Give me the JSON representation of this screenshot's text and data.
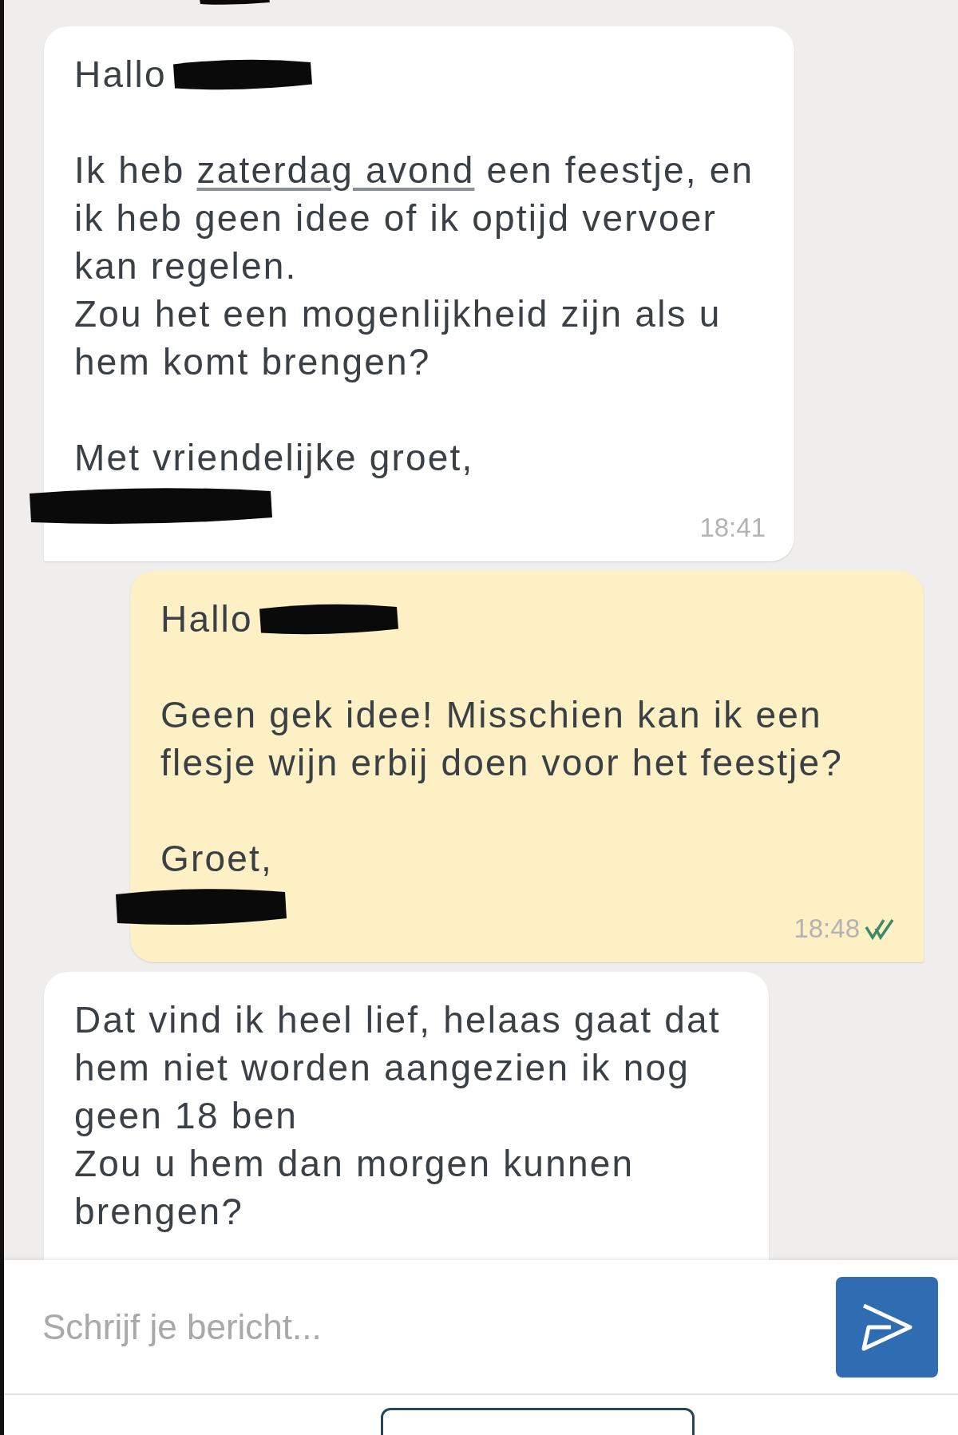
{
  "previous_message": {
    "redacted": true
  },
  "messages": [
    {
      "kind": "incoming",
      "greeting": {
        "text": "Hallo",
        "redacted": true
      },
      "paragraphs": [
        {
          "lines": [
            {
              "segments": [
                {
                  "text": "Ik heb ",
                  "kind": "text"
                },
                {
                  "text": "zaterdag avond",
                  "kind": "link"
                },
                {
                  "text": " een feestje, en ik heb geen idee of ik optijd vervoer kan regelen.",
                  "kind": "text"
                }
              ]
            },
            {
              "segments": [
                {
                  "text": "Zou het een mogenlijkheid zijn als u hem komt brengen?",
                  "kind": "text"
                }
              ]
            }
          ]
        }
      ],
      "closing": "Met vriendelijke groet,",
      "signature_redacted": true,
      "time": "18:41"
    },
    {
      "kind": "outgoing",
      "greeting": {
        "text": "Hallo",
        "redacted": true
      },
      "paragraphs": [
        {
          "lines": [
            {
              "segments": [
                {
                  "text": "Geen gek idee! Misschien kan ik een flesje wijn erbij doen voor het feestje?",
                  "kind": "text"
                }
              ]
            }
          ]
        }
      ],
      "closing": "Groet,",
      "signature_redacted": true,
      "time": "18:48",
      "read": true
    },
    {
      "kind": "incoming",
      "paragraphs": [
        {
          "lines": [
            {
              "segments": [
                {
                  "text": "Dat vind ik heel lief, helaas gaat dat hem niet worden aangezien ik nog geen 18 ben",
                  "kind": "text"
                }
              ]
            },
            {
              "segments": [
                {
                  "text": "Zou u hem dan morgen kunnen brengen?",
                  "kind": "text"
                }
              ]
            }
          ]
        }
      ]
    }
  ],
  "composer": {
    "placeholder": "Schrijf je bericht..."
  }
}
